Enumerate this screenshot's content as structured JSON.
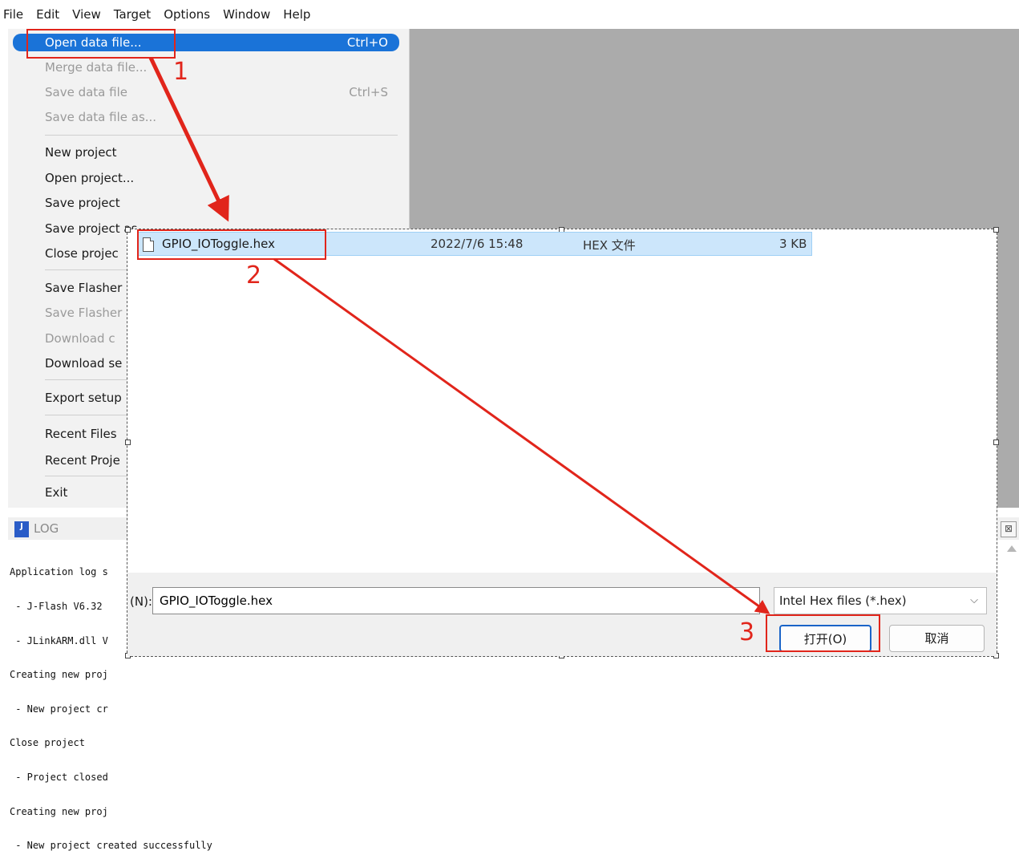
{
  "menubar": {
    "items": [
      "File",
      "Edit",
      "View",
      "Target",
      "Options",
      "Window",
      "Help"
    ]
  },
  "file_menu": {
    "items": [
      {
        "label": "Open data file...",
        "shortcut": "Ctrl+O"
      },
      {
        "label": "Merge data file..."
      },
      {
        "label": "Save data file",
        "shortcut": "Ctrl+S"
      },
      {
        "label": "Save data file as..."
      },
      {
        "label": "New project"
      },
      {
        "label": "Open project..."
      },
      {
        "label": "Save project"
      },
      {
        "label": "Save project as"
      },
      {
        "label": "Close projec"
      },
      {
        "label": "Save Flasher"
      },
      {
        "label": "Save Flasher"
      },
      {
        "label": "Download c"
      },
      {
        "label": "Download se"
      },
      {
        "label": "Export setup"
      },
      {
        "label": "Recent Files"
      },
      {
        "label": "Recent Proje"
      },
      {
        "label": "Exit"
      }
    ]
  },
  "log": {
    "title": "LOG",
    "icon_text": "J",
    "lines": [
      "Application log s",
      " - J-Flash V6.32",
      " - JLinkARM.dll V",
      "Creating new proj",
      " - New project cr",
      "Close project",
      " - Project closed",
      "Creating new proj",
      " - New project created successfully"
    ],
    "close_glyph": "⊠"
  },
  "dialog": {
    "file": {
      "name": "GPIO_IOToggle.hex",
      "date": "2022/7/6 15:48",
      "type": "HEX 文件",
      "size": "3 KB"
    },
    "filename_label": "(N):",
    "filename_value": "GPIO_IOToggle.hex",
    "filter": "Intel Hex files (*.hex)",
    "open_button": "打开(O)",
    "cancel_button": "取消"
  },
  "annotations": {
    "step1": "1",
    "step2": "2",
    "step3": "3",
    "color": "#e1251b"
  },
  "colors": {
    "menu_highlight": "#1a73d8",
    "workspace": "#ababab",
    "selected_row": "#cce6fb"
  }
}
